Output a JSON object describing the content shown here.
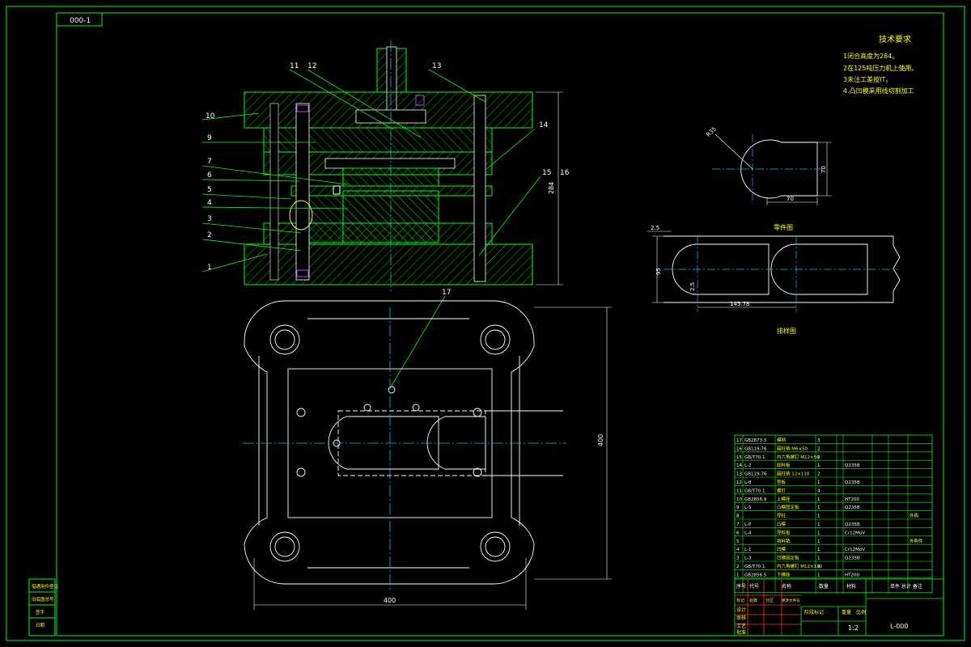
{
  "drawing": {
    "code_top": "000-1",
    "code_bottom": "L-000",
    "scale": "1:2"
  },
  "tech_requirements": {
    "title": "技术要求",
    "lines": [
      "1闭合高度为284。",
      "2在125吨压力机上使用。",
      "3未注工差按IT。",
      "4.凸凹模采用线切割加工"
    ]
  },
  "views": {
    "blank_title": "零件图",
    "layout_title": "排样图"
  },
  "dims": {
    "closed_height": "284",
    "base_width": "400",
    "base_height": "400",
    "part_radius": "R35",
    "part_width": "70",
    "part_height": "70",
    "strip_margin": "2.5",
    "strip_width": "95",
    "strip_gap": "2.5",
    "pitch": "145.78"
  },
  "callouts": [
    "1",
    "2",
    "3",
    "4",
    "5",
    "6",
    "7",
    "9",
    "10",
    "11",
    "12",
    "13",
    "14",
    "15",
    "16",
    "17"
  ],
  "bom": [
    {
      "no": "17",
      "code": "GB2873.3",
      "name": "模柄",
      "qty": "3",
      "mat": "",
      "note": ""
    },
    {
      "no": "16",
      "code": "GB119-76",
      "name": "圆柱销 M6×50",
      "qty": "2",
      "mat": "",
      "note": ""
    },
    {
      "no": "15",
      "code": "GB/T70.1",
      "name": "内六角螺钉 M12×56",
      "qty": "2",
      "mat": "",
      "note": ""
    },
    {
      "no": "14",
      "code": "L-2",
      "name": "卸料板",
      "qty": "1",
      "mat": "Q235B",
      "note": ""
    },
    {
      "no": "13",
      "code": "GB119-76",
      "name": "圆柱销 12×110",
      "qty": "2",
      "mat": "",
      "note": ""
    },
    {
      "no": "12",
      "code": "L-8",
      "name": "垫板",
      "qty": "1",
      "mat": "Q235B",
      "note": ""
    },
    {
      "no": "11",
      "code": "GB/T70.1",
      "name": "螺钉",
      "qty": "4",
      "mat": "",
      "note": ""
    },
    {
      "no": "10",
      "code": "GB2856.9",
      "name": "上模座",
      "qty": "1",
      "mat": "HT200",
      "note": ""
    },
    {
      "no": "9",
      "code": "L-5",
      "name": "凸模固定板",
      "qty": "1",
      "mat": "Q235B",
      "note": ""
    },
    {
      "no": "8",
      "code": "",
      "name": "导柱",
      "qty": "1",
      "mat": "",
      "note": "外购"
    },
    {
      "no": "7",
      "code": "L-P",
      "name": "凸模",
      "qty": "1",
      "mat": "Q235B",
      "note": ""
    },
    {
      "no": "6",
      "code": "L-4",
      "name": "导料板",
      "qty": "1",
      "mat": "Cr12MoV",
      "note": ""
    },
    {
      "no": "5",
      "code": "",
      "name": "挡料销",
      "qty": "1",
      "mat": "",
      "note": "外购件"
    },
    {
      "no": "4",
      "code": "L-1",
      "name": "凹模",
      "qty": "1",
      "mat": "Cr12MoV",
      "note": ""
    },
    {
      "no": "3",
      "code": "L-3",
      "name": "凹模固定板",
      "qty": "1",
      "mat": "Q235B",
      "note": ""
    },
    {
      "no": "2",
      "code": "GB/T70.1",
      "name": "内六角螺钉 M12×110",
      "qty": "4",
      "mat": "",
      "note": ""
    },
    {
      "no": "1",
      "code": "GB2856.5",
      "name": "下模座",
      "qty": "1",
      "mat": "HT200",
      "note": ""
    }
  ],
  "bom_header": {
    "no": "序号",
    "code": "代号",
    "name": "名称",
    "qty": "数量",
    "mat": "材料",
    "weight": "单件 总计",
    "weight2": "重量",
    "note": "备注"
  },
  "title_block": {
    "rows": [
      "设计",
      "审核",
      "工艺",
      "批准"
    ],
    "cols": [
      "标记",
      "处数",
      "分区",
      "更改文件号",
      "签名",
      "年月日"
    ],
    "stage": "阶段标记",
    "weight": "重量",
    "ratio": "比例"
  },
  "side_table": [
    "借通用件登记",
    "旧底图总号",
    "签字",
    "日期"
  ]
}
